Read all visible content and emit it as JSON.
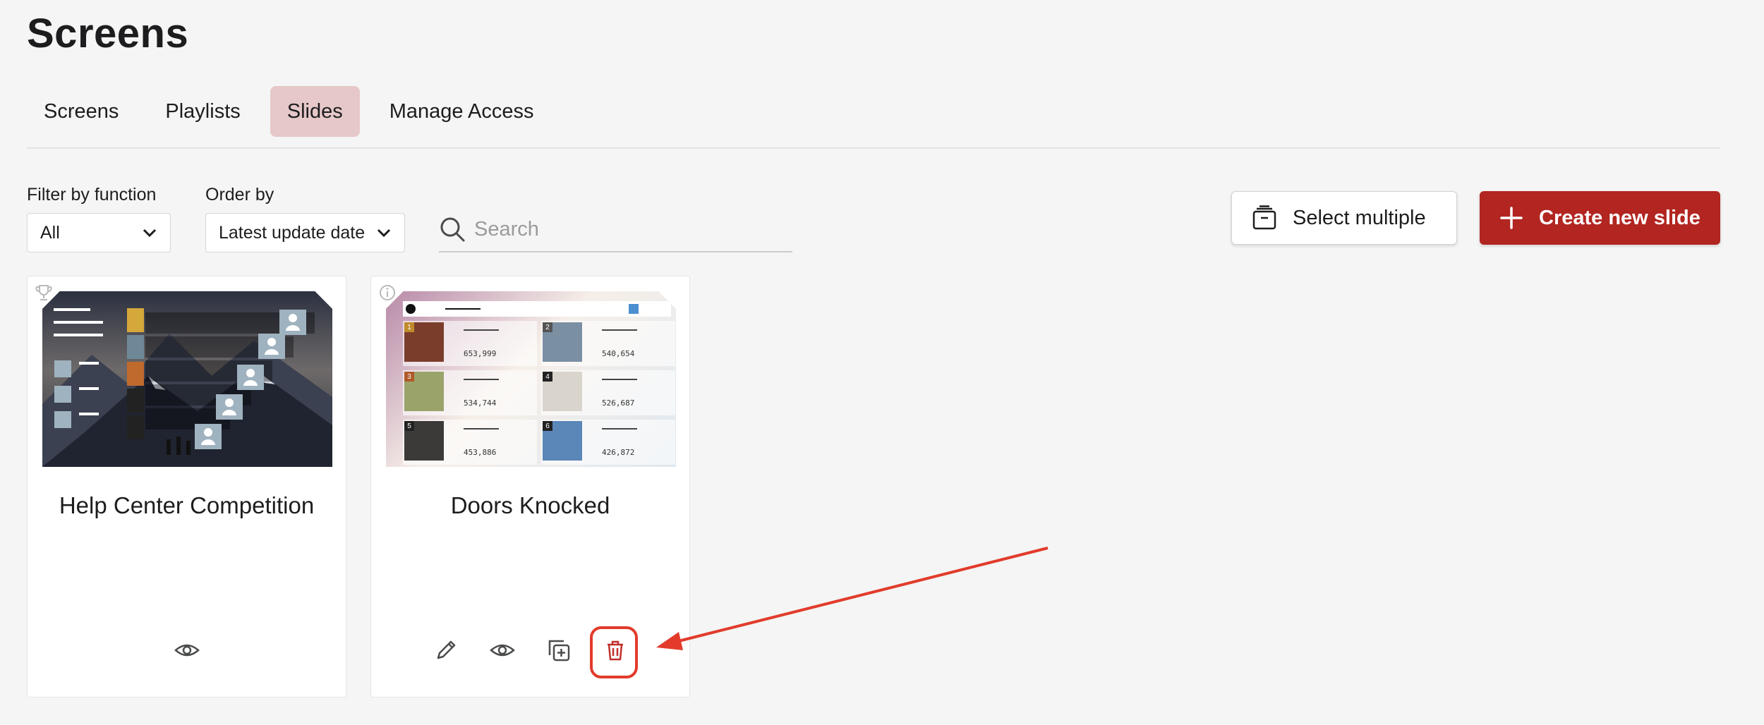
{
  "page": {
    "title": "Screens"
  },
  "tabs": [
    {
      "label": "Screens",
      "active": false
    },
    {
      "label": "Playlists",
      "active": false
    },
    {
      "label": "Slides",
      "active": true
    },
    {
      "label": "Manage Access",
      "active": false
    }
  ],
  "filters": {
    "function_label": "Filter by function",
    "function_value": "All",
    "order_label": "Order by",
    "order_value": "Latest update date",
    "search_placeholder": "Search"
  },
  "toolbar": {
    "select_multiple_label": "Select multiple",
    "create_label": "Create new slide"
  },
  "slides": [
    {
      "title": "Help Center Competition",
      "corner_icon": "trophy-icon",
      "actions": [
        "eye-icon"
      ]
    },
    {
      "title": "Doors Knocked",
      "corner_icon": "info-icon",
      "actions": [
        "pencil-icon",
        "eye-icon",
        "duplicate-icon",
        "trash-icon"
      ],
      "preview": {
        "values": [
          "653,999",
          "540,654",
          "534,744",
          "526,687",
          "453,886",
          "426,872"
        ],
        "ranks": [
          "1",
          "2",
          "3",
          "4",
          "5",
          "6"
        ]
      }
    }
  ],
  "colors": {
    "accent": "#b22521",
    "active_tab": "#e6c8c8",
    "annotation": "#e23b2b",
    "background": "#f4f5f4"
  }
}
